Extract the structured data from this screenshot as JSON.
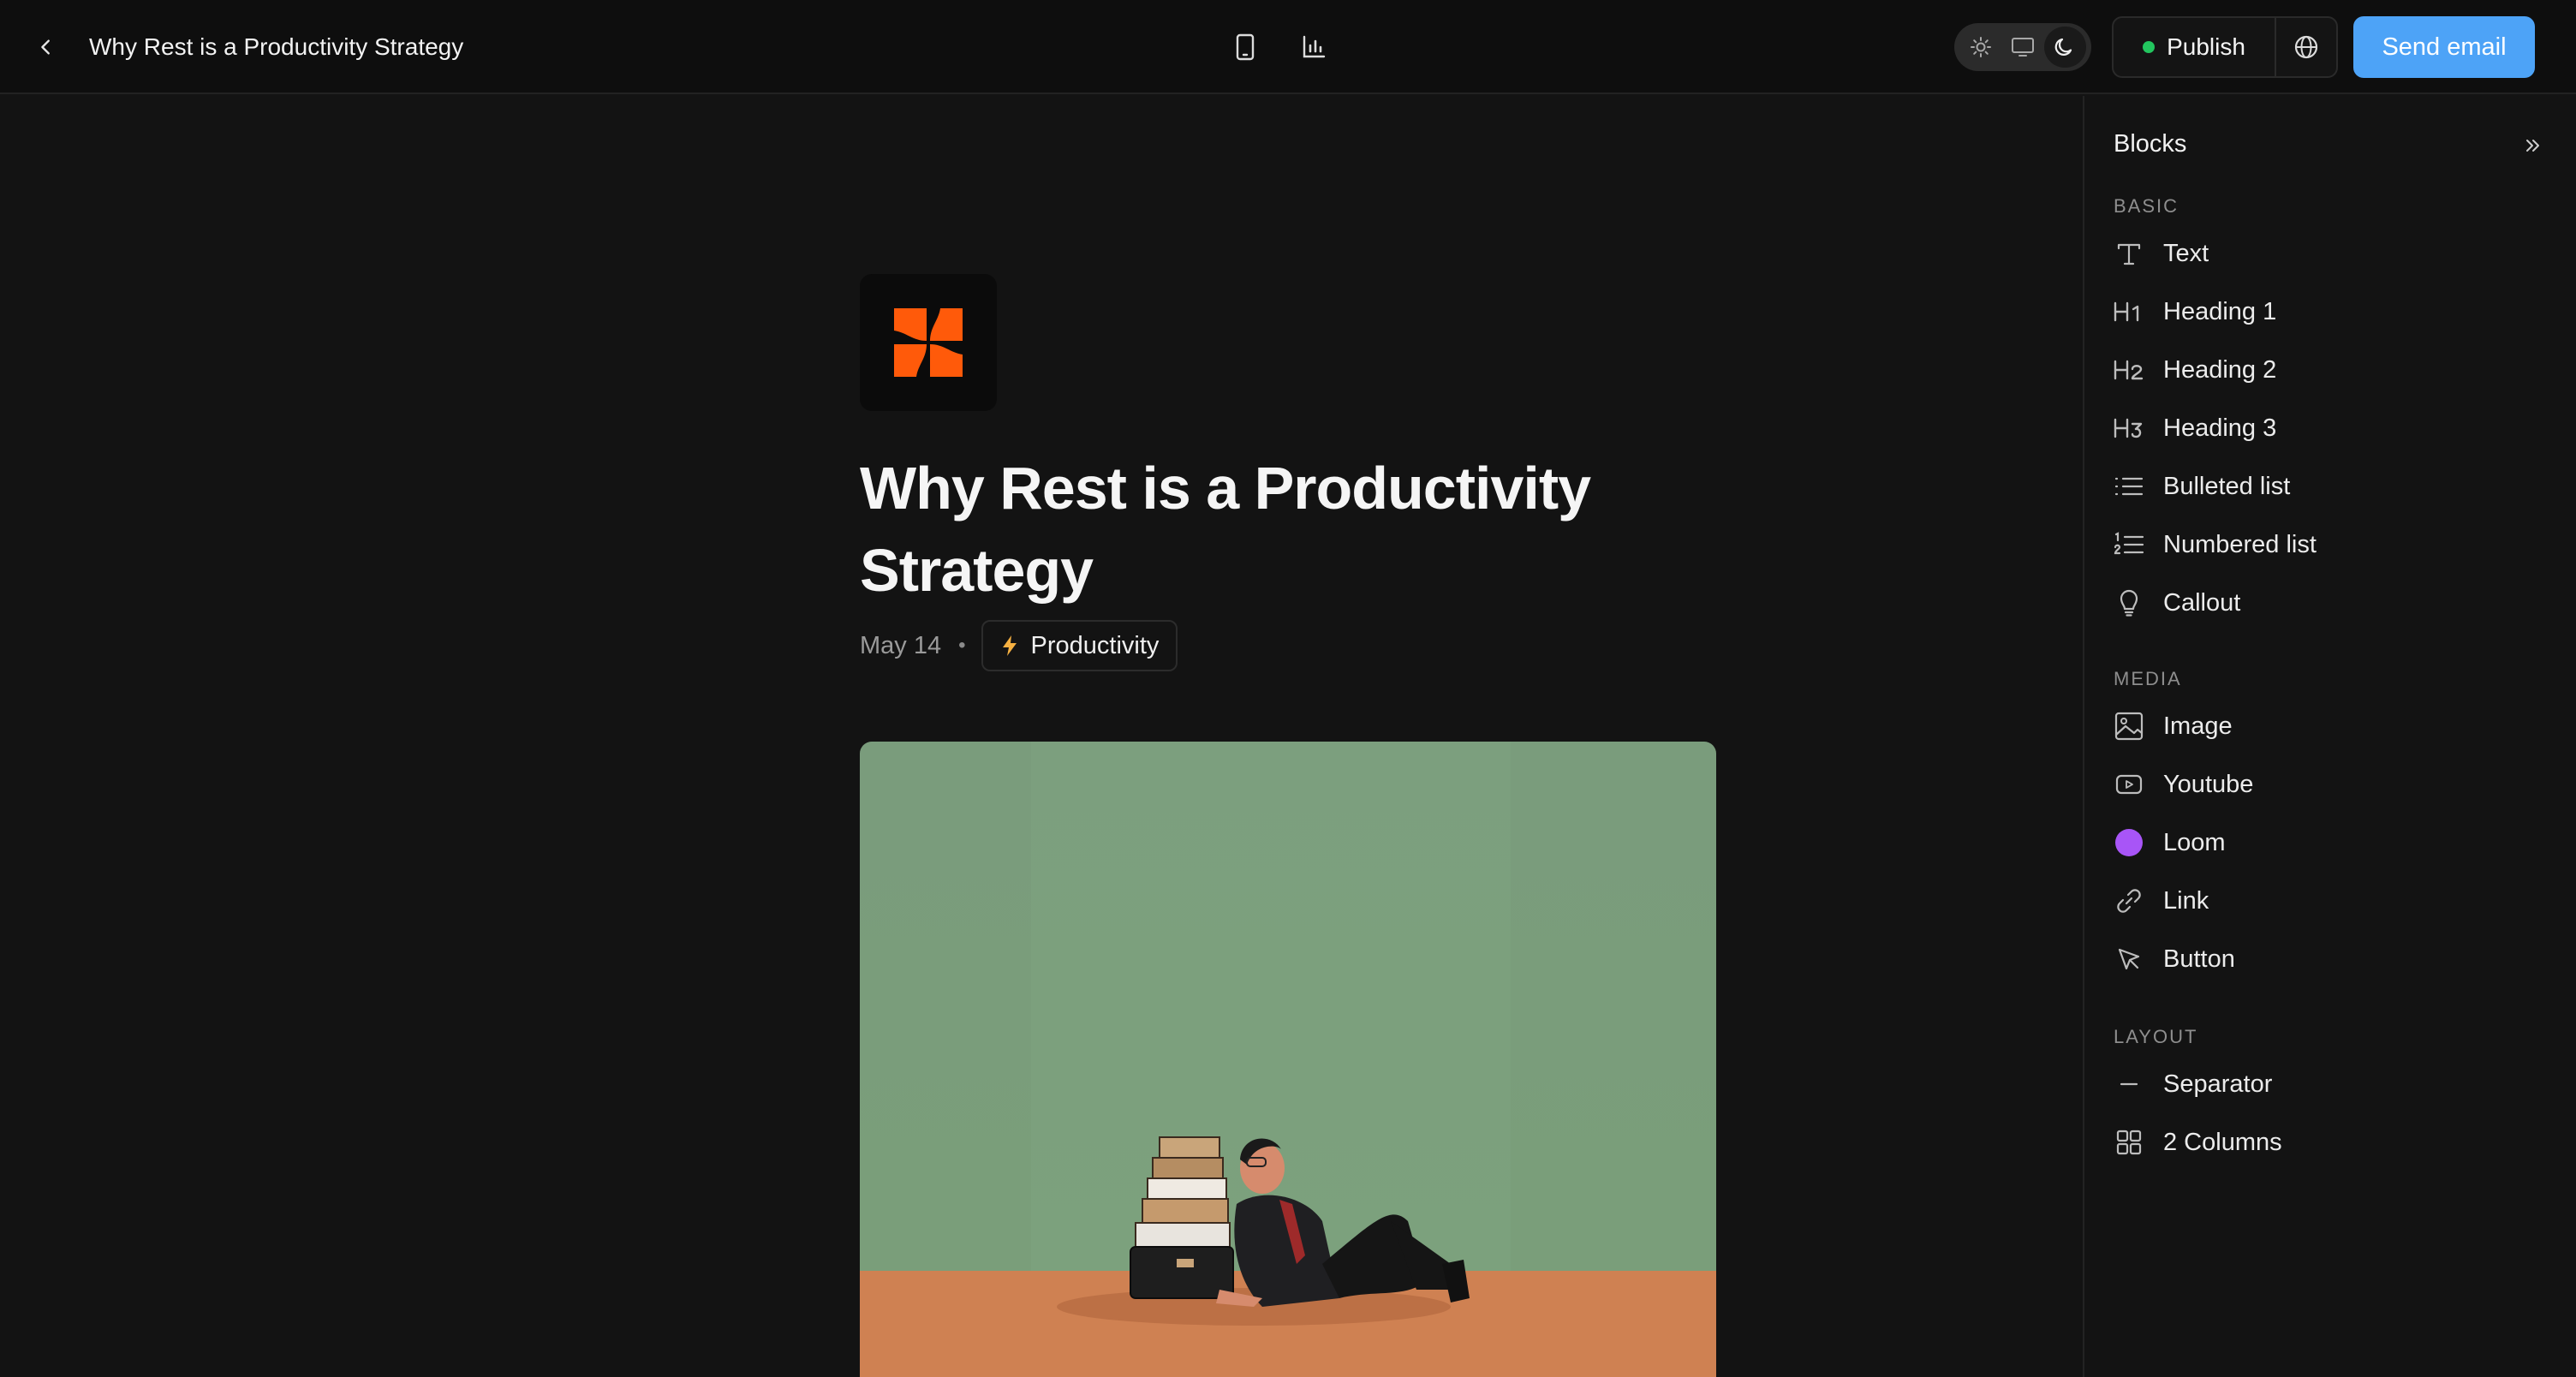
{
  "topbar": {
    "title": "Why Rest is a Productivity Strategy",
    "publish_label": "Publish",
    "send_email_label": "Send email"
  },
  "article": {
    "title": "Why Rest is a Productivity Strategy",
    "date": "May 14",
    "separator": "•",
    "tag_label": "Productivity"
  },
  "panel": {
    "title": "Blocks",
    "sections": [
      {
        "label": "BASIC"
      },
      {
        "label": "MEDIA"
      },
      {
        "label": "LAYOUT"
      }
    ],
    "items": [
      {
        "label": "Text",
        "icon": "text-icon"
      },
      {
        "label": "Heading 1",
        "icon": "heading1-icon"
      },
      {
        "label": "Heading 2",
        "icon": "heading2-icon"
      },
      {
        "label": "Heading 3",
        "icon": "heading3-icon"
      },
      {
        "label": "Bulleted list",
        "icon": "bulleted-list-icon"
      },
      {
        "label": "Numbered list",
        "icon": "numbered-list-icon"
      },
      {
        "label": "Callout",
        "icon": "lightbulb-icon"
      },
      {
        "label": "Image",
        "icon": "image-icon"
      },
      {
        "label": "Youtube",
        "icon": "youtube-icon"
      },
      {
        "label": "Loom",
        "icon": "loom-icon"
      },
      {
        "label": "Link",
        "icon": "link-icon"
      },
      {
        "label": "Button",
        "icon": "cursor-icon"
      },
      {
        "label": "Separator",
        "icon": "separator-icon"
      },
      {
        "label": "2 Columns",
        "icon": "columns-icon"
      }
    ]
  },
  "colors": {
    "accent": "#4da3f7",
    "publish_dot": "#22c55e",
    "logo": "#ff5a0a",
    "loom": "#a855f7"
  }
}
